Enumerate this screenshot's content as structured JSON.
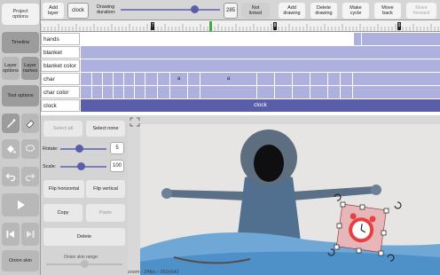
{
  "left": {
    "project_options": "Project\noptions",
    "timeline": "Timeline",
    "layer_options": "Layer\noptions",
    "layer_names": "Layer\nnames",
    "tool_options": "Tool options",
    "onion_skin": "Onion skin"
  },
  "toolbar": {
    "add_layer": "Add\nlayer",
    "layer_name": "clock",
    "drawing_duration_label": "Drawing\nduration:",
    "drawing_duration_value": "285",
    "not_linked": "Not\nlinked",
    "add_drawing": "Add\ndrawing",
    "delete_drawing": "Delete\ndrawing",
    "make_cycle": "Make\ncycle",
    "move_back": "Move\nback",
    "move_forward": "Move\nforward"
  },
  "ruler": {
    "markers": [
      "7",
      "8",
      "9"
    ]
  },
  "layers": [
    {
      "name": "hands",
      "label": ""
    },
    {
      "name": "blanket",
      "label": ""
    },
    {
      "name": "blanket color",
      "label": ""
    },
    {
      "name": "char",
      "labels": [
        "a",
        "a"
      ]
    },
    {
      "name": "char color",
      "label": ""
    },
    {
      "name": "clock",
      "label": "clock"
    }
  ],
  "tool_options": {
    "select_all": "Select all",
    "select_none": "Select none",
    "rotate_label": "Rotate:",
    "rotate_value": "5",
    "rotate_level": 0.4,
    "scale_label": "Scale:",
    "scale_value": "100",
    "scale_level": 0.45,
    "flip_horizontal": "Flip horizontal",
    "flip_vertical": "Flip vertical",
    "copy": "Copy",
    "paste": "Paste",
    "delete": "Delete",
    "onion_skin_range": "Onion skin range:"
  },
  "canvas": {
    "status": "zoom - 24fps - 950x542"
  },
  "colors": {
    "track": "#aeb0dd",
    "track_dark": "#5a5da8",
    "panel": "#d4d4d4"
  }
}
